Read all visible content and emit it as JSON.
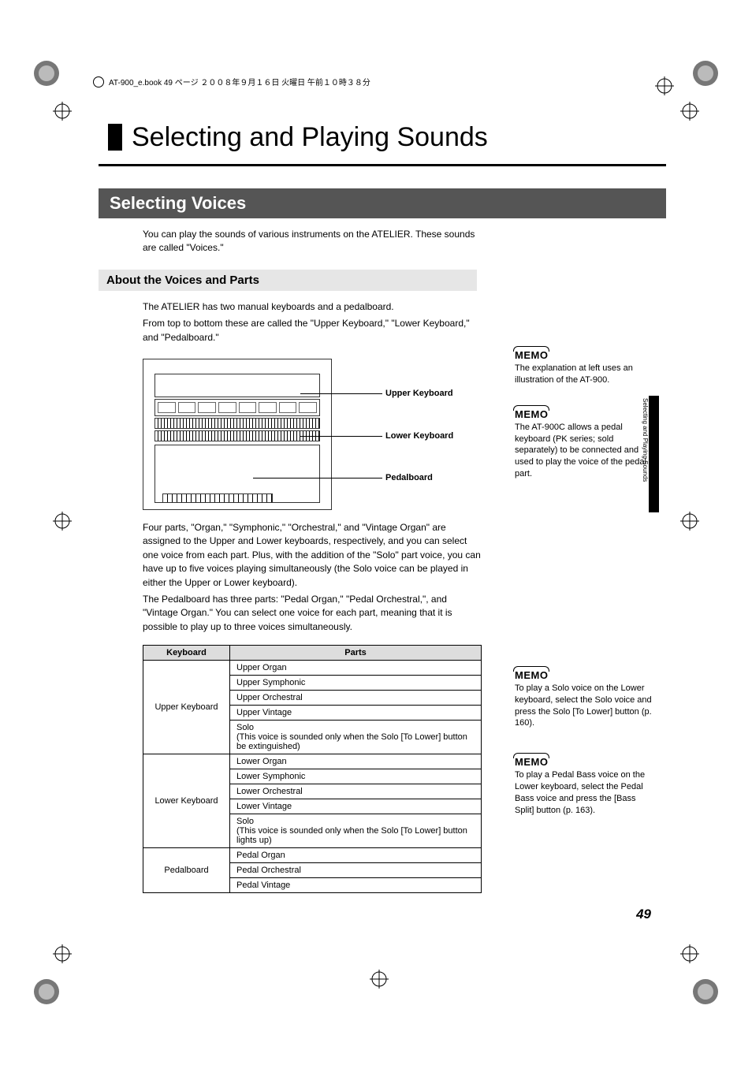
{
  "meta": {
    "header": "AT-900_e.book 49 ページ ２００８年９月１６日 火曜日 午前１０時３８分"
  },
  "chapter": {
    "title": "Selecting and Playing Sounds"
  },
  "section": {
    "title": "Selecting Voices",
    "intro": "You can play the sounds of various instruments on the ATELIER. These sounds are called \"Voices.\""
  },
  "subhead": {
    "text": "About the Voices and Parts"
  },
  "about": {
    "p1": "The ATELIER has two manual keyboards and a pedalboard.",
    "p2": "From top to bottom these are called the \"Upper Keyboard,\" \"Lower Keyboard,\" and \"Pedalboard.\""
  },
  "illustration": {
    "upper": "Upper Keyboard",
    "lower": "Lower Keyboard",
    "pedal": "Pedalboard"
  },
  "parts": {
    "p1": "Four parts, \"Organ,\" \"Symphonic,\" \"Orchestral,\" and \"Vintage Organ\" are assigned to the Upper and Lower keyboards, respectively, and you can select one voice from each part. Plus, with the addition of the \"Solo\" part voice, you can have up to five voices playing simultaneously (the Solo voice can be played in either the Upper or Lower keyboard).",
    "p2": "The Pedalboard has three parts: \"Pedal Organ,\" \"Pedal Orchestral,\", and \"Vintage Organ.\" You can select one voice for each part, meaning that it is possible to play up to three voices simultaneously."
  },
  "table": {
    "head": {
      "keyboard": "Keyboard",
      "parts": "Parts"
    },
    "upper": {
      "name": "Upper Keyboard",
      "rows": [
        "Upper Organ",
        "Upper Symphonic",
        "Upper Orchestral",
        "Upper Vintage",
        "Solo\n(This voice is sounded only when the Solo [To Lower] button be extinguished)"
      ]
    },
    "lower": {
      "name": "Lower Keyboard",
      "rows": [
        "Lower Organ",
        "Lower Symphonic",
        "Lower Orchestral",
        "Lower Vintage",
        "Solo\n(This voice is sounded only when the Solo [To Lower] button lights up)"
      ]
    },
    "pedal": {
      "name": "Pedalboard",
      "rows": [
        "Pedal Organ",
        "Pedal Orchestral",
        "Pedal Vintage"
      ]
    }
  },
  "memos": {
    "tag": "MEMO",
    "m1": "The explanation at left uses an illustration of the AT-900.",
    "m2": "The AT-900C allows a pedal keyboard (PK series; sold separately) to be connected and used to play the voice of the pedal part.",
    "m3": "To play a Solo voice on the Lower keyboard, select the Solo voice and press the Solo [To Lower] button (p. 160).",
    "m4": "To play a Pedal Bass voice on the Lower keyboard, select the Pedal Bass voice and press the [Bass Split] button (p. 163)."
  },
  "tab": {
    "text": "Selecting and Playing Sounds"
  },
  "page": {
    "num": "49"
  }
}
